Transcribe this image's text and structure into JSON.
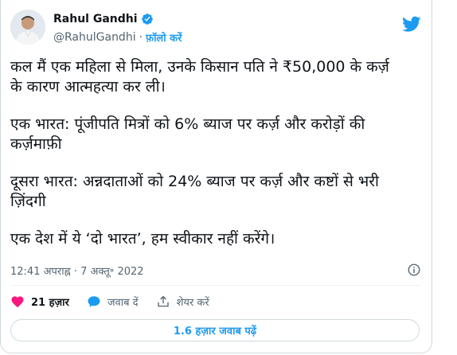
{
  "author": {
    "display_name": "Rahul Gandhi",
    "handle": "@RahulGandhi",
    "separator": "·",
    "follow_label": "फ़ॉलो करें"
  },
  "tweet": {
    "paragraphs": [
      "कल मैं एक महिला से मिला, उनके किसान पति ने ₹50,000 के कर्ज़\nके कारण आत्महत्या कर ली।",
      "एक भारत: पूंजीपति मित्रों को 6% ब्याज पर कर्ज़ और करोड़ों की\nकर्ज़माफ़ी",
      "दूसरा भारत: अन्नदाताओं को 24% ब्याज पर कर्ज़ और कष्टों से भरी\nज़िंदगी",
      "एक देश में ये ‘दो भारत’, हम स्वीकार नहीं करेंगे।"
    ],
    "timestamp": "12:41 अपराह्न · 7 अक्तू॰ 2022"
  },
  "actions": {
    "likes": "21 हज़ार",
    "reply_label": "जवाब दें",
    "share_label": "शेयर करें"
  },
  "replies_button_label": "1.6 हज़ार जवाब पढ़ें",
  "colors": {
    "accent": "#1d9bf0",
    "like": "#f91880",
    "text": "#0f1419",
    "muted": "#536471",
    "border": "#cfd9de"
  },
  "icons": [
    "verified-badge-icon",
    "twitter-bird-icon",
    "info-icon",
    "heart-icon",
    "reply-bubble-icon",
    "share-icon"
  ]
}
